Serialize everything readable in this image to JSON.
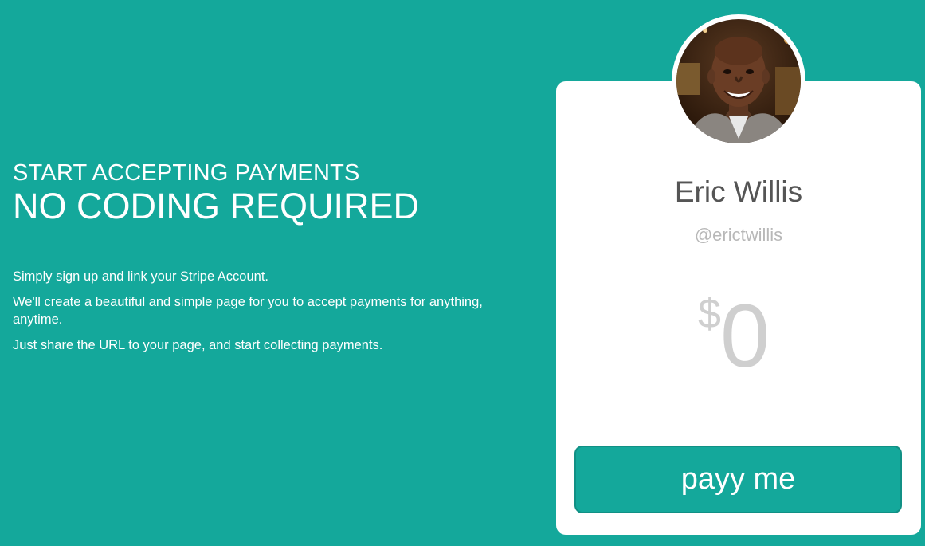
{
  "hero": {
    "kicker": "START ACCEPTING PAYMENTS",
    "headline": "NO CODING REQUIRED",
    "paragraphs": [
      "Simply sign up and link your Stripe Account.",
      "We'll create a beautiful and simple page for you to accept payments for anything, anytime.",
      "Just share the URL to your page, and start collecting payments."
    ]
  },
  "profile_card": {
    "name": "Eric Willis",
    "handle": "@erictwillis",
    "currency_symbol": "$",
    "amount": "0",
    "button_label": "payy me",
    "avatar_icon": "profile-photo"
  },
  "colors": {
    "background": "#14a89b",
    "card": "#ffffff",
    "button": "#14a89b"
  }
}
